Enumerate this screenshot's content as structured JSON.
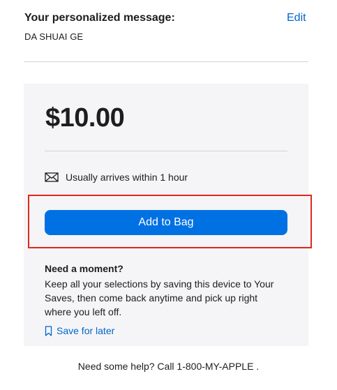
{
  "message": {
    "heading": "Your personalized message:",
    "edit_label": "Edit",
    "value": "DA SHUAI GE"
  },
  "purchase": {
    "price": "$10.00",
    "delivery_text": "Usually arrives within 1 hour",
    "delivery_icon": "envelope-icon",
    "add_to_bag_label": "Add to Bag"
  },
  "save": {
    "title": "Need a moment?",
    "body": "Keep all your selections by saving this device to Your Saves, then come back anytime and pick up right where you left off.",
    "link_label": "Save for later",
    "link_icon": "bookmark-icon"
  },
  "help": {
    "text": "Need some help? Call 1-800-MY-APPLE ."
  },
  "colors": {
    "link": "#0066cc",
    "button": "#0071e3",
    "panel_bg": "#f5f5f7",
    "highlight": "#e0271b"
  }
}
